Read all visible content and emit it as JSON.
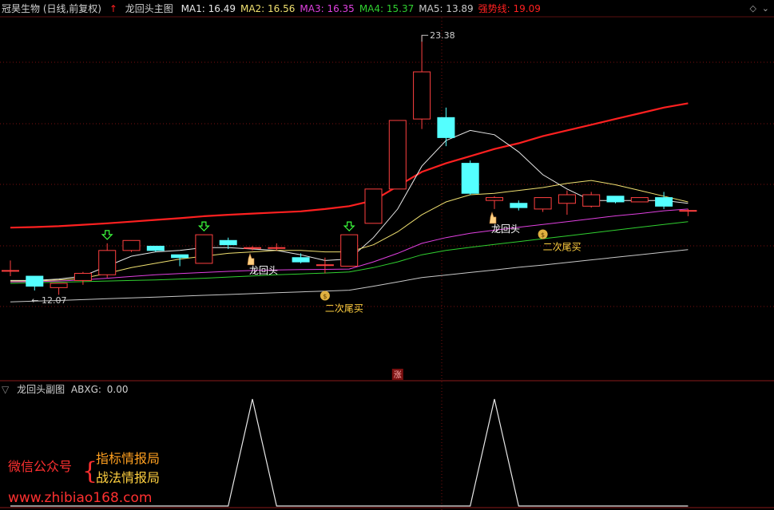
{
  "main_header": {
    "stock": "冠昊生物 (日线,前复权)",
    "indicator": "龙回头主图",
    "ma": [
      {
        "label": "MA1:",
        "value": "16.49",
        "color": "#e8e8e8"
      },
      {
        "label": "MA2:",
        "value": "16.56",
        "color": "#f0e070"
      },
      {
        "label": "MA3:",
        "value": "16.35",
        "color": "#e040e0"
      },
      {
        "label": "MA4:",
        "value": "15.37",
        "color": "#30d030"
      },
      {
        "label": "MA5:",
        "value": "13.89",
        "color": "#c8c8c8"
      },
      {
        "label": "强势线:",
        "value": "19.09",
        "color": "#ff2020"
      }
    ]
  },
  "sub_header": {
    "indicator": "龙回头副图",
    "label": "ABXG:",
    "value": "0.00"
  },
  "chart_data": [
    {
      "type": "candlestick",
      "panel": "main",
      "price_range": [
        11.6,
        24.0
      ],
      "candles": [
        {
          "o": 15.15,
          "h": 15.5,
          "l": 14.95,
          "c": 15.15
        },
        {
          "o": 14.95,
          "h": 14.95,
          "l": 14.45,
          "c": 14.6
        },
        {
          "o": 14.55,
          "h": 14.7,
          "l": 14.3,
          "c": 14.7
        },
        {
          "o": 14.8,
          "h": 15.1,
          "l": 14.65,
          "c": 15.05
        },
        {
          "o": 15.0,
          "h": 16.1,
          "l": 14.9,
          "c": 15.85
        },
        {
          "o": 15.85,
          "h": 16.2,
          "l": 15.8,
          "c": 16.2
        },
        {
          "o": 16.0,
          "h": 16.0,
          "l": 15.8,
          "c": 15.85
        },
        {
          "o": 15.7,
          "h": 15.7,
          "l": 15.3,
          "c": 15.6
        },
        {
          "o": 15.4,
          "h": 16.4,
          "l": 15.4,
          "c": 16.4
        },
        {
          "o": 16.2,
          "h": 16.3,
          "l": 15.9,
          "c": 16.05
        },
        {
          "o": 15.95,
          "h": 16.0,
          "l": 15.85,
          "c": 15.95
        },
        {
          "o": 15.95,
          "h": 16.1,
          "l": 15.85,
          "c": 15.95
        },
        {
          "o": 15.6,
          "h": 15.75,
          "l": 15.4,
          "c": 15.45
        },
        {
          "o": 15.35,
          "h": 15.6,
          "l": 15.05,
          "c": 15.35
        },
        {
          "o": 15.3,
          "h": 16.4,
          "l": 15.3,
          "c": 16.4
        },
        {
          "o": 16.8,
          "h": 18.0,
          "l": 17.2,
          "c": 18.0
        },
        {
          "o": 18.0,
          "h": 20.4,
          "l": 18.0,
          "c": 20.4
        },
        {
          "o": 20.45,
          "h": 23.38,
          "l": 20.1,
          "c": 22.1
        },
        {
          "o": 20.5,
          "h": 20.85,
          "l": 19.5,
          "c": 19.8
        },
        {
          "o": 18.9,
          "h": 19.0,
          "l": 17.8,
          "c": 17.85
        },
        {
          "o": 17.6,
          "h": 17.75,
          "l": 17.3,
          "c": 17.7
        },
        {
          "o": 17.5,
          "h": 17.6,
          "l": 17.25,
          "c": 17.35
        },
        {
          "o": 17.3,
          "h": 17.7,
          "l": 17.2,
          "c": 17.7
        },
        {
          "o": 17.5,
          "h": 17.95,
          "l": 17.1,
          "c": 17.8
        },
        {
          "o": 17.4,
          "h": 17.9,
          "l": 17.35,
          "c": 17.8
        },
        {
          "o": 17.75,
          "h": 17.75,
          "l": 17.5,
          "c": 17.55
        },
        {
          "o": 17.55,
          "h": 17.7,
          "l": 17.55,
          "c": 17.7
        },
        {
          "o": 17.7,
          "h": 17.9,
          "l": 17.3,
          "c": 17.4
        },
        {
          "o": 17.25,
          "h": 17.3,
          "l": 17.05,
          "c": 17.25
        }
      ],
      "series": [
        {
          "name": "强势线",
          "color": "#ff2020",
          "width": 2.2,
          "values": [
            16.65,
            16.67,
            16.7,
            16.75,
            16.8,
            16.86,
            16.92,
            16.98,
            17.05,
            17.1,
            17.14,
            17.18,
            17.22,
            17.3,
            17.4,
            17.6,
            18.1,
            18.6,
            18.9,
            19.15,
            19.4,
            19.6,
            19.85,
            20.05,
            20.25,
            20.45,
            20.65,
            20.85,
            21.0
          ]
        },
        {
          "name": "MA1",
          "color": "#e8e8e8",
          "width": 1,
          "values": [
            14.8,
            14.8,
            14.85,
            14.95,
            15.3,
            15.65,
            15.8,
            15.85,
            15.95,
            15.95,
            15.9,
            15.85,
            15.7,
            15.5,
            15.55,
            16.3,
            17.3,
            18.8,
            19.7,
            20.05,
            19.9,
            19.3,
            18.5,
            18.0,
            17.6,
            17.6,
            17.6,
            17.6,
            17.5
          ]
        },
        {
          "name": "MA2",
          "color": "#f0e070",
          "width": 1,
          "values": [
            14.78,
            14.78,
            14.82,
            14.88,
            15.05,
            15.25,
            15.4,
            15.55,
            15.65,
            15.75,
            15.8,
            15.85,
            15.85,
            15.8,
            15.8,
            16.05,
            16.5,
            17.1,
            17.55,
            17.8,
            17.85,
            17.95,
            18.05,
            18.2,
            18.3,
            18.15,
            17.95,
            17.75,
            17.55
          ]
        },
        {
          "name": "MA3",
          "color": "#e040e0",
          "width": 1,
          "values": [
            14.75,
            14.76,
            14.78,
            14.82,
            14.88,
            14.94,
            15.0,
            15.04,
            15.08,
            15.12,
            15.15,
            15.17,
            15.18,
            15.19,
            15.2,
            15.45,
            15.75,
            16.1,
            16.3,
            16.45,
            16.56,
            16.66,
            16.76,
            16.86,
            16.96,
            17.06,
            17.14,
            17.24,
            17.3
          ]
        },
        {
          "name": "MA4",
          "color": "#30d030",
          "width": 1,
          "values": [
            14.7,
            14.72,
            14.74,
            14.76,
            14.78,
            14.8,
            14.82,
            14.85,
            14.88,
            14.92,
            14.96,
            15.0,
            15.03,
            15.06,
            15.1,
            15.25,
            15.45,
            15.7,
            15.85,
            15.96,
            16.06,
            16.16,
            16.26,
            16.36,
            16.46,
            16.56,
            16.66,
            16.76,
            16.86
          ]
        },
        {
          "name": "MA5",
          "color": "#c8c8c8",
          "width": 1,
          "values": [
            14.05,
            14.08,
            14.1,
            14.13,
            14.16,
            14.19,
            14.22,
            14.25,
            14.28,
            14.31,
            14.34,
            14.37,
            14.4,
            14.43,
            14.46,
            14.6,
            14.75,
            14.9,
            14.99,
            15.08,
            15.17,
            15.26,
            15.34,
            15.43,
            15.52,
            15.61,
            15.7,
            15.79,
            15.88
          ]
        }
      ],
      "annotations": [
        {
          "text": "23.38",
          "kind": "high",
          "index": 17,
          "price": 23.38
        },
        {
          "text": "12.07",
          "kind": "low",
          "index": 1,
          "price": 14.45
        },
        {
          "text": "龙回头",
          "kind": "signal",
          "index": 10,
          "color": "#ffffff"
        },
        {
          "text": "二次尾买",
          "kind": "signal",
          "index": 13,
          "color": "#ffd040"
        },
        {
          "text": "龙回头",
          "kind": "signal",
          "index": 20,
          "color": "#ffffff"
        },
        {
          "text": "二次尾买",
          "kind": "signal",
          "index": 22,
          "color": "#ffd040"
        },
        {
          "text": "涨",
          "kind": "badge",
          "index": 16
        }
      ],
      "buy_arrows": [
        4,
        8,
        14
      ]
    },
    {
      "type": "line",
      "panel": "sub",
      "name": "ABXG",
      "ylim": [
        0,
        1
      ],
      "values": [
        0,
        0,
        0,
        0,
        0,
        0,
        0,
        0,
        0,
        0,
        1,
        0,
        0,
        0,
        0,
        0,
        0,
        0,
        0,
        0,
        1,
        0,
        0,
        0,
        0,
        0,
        0,
        0,
        0
      ]
    }
  ],
  "watermark": {
    "wechat": "微信公众号",
    "brace": "{",
    "line1": "指标情报局",
    "line2": "战法情报局",
    "url": "www.zhibiao168.com"
  }
}
